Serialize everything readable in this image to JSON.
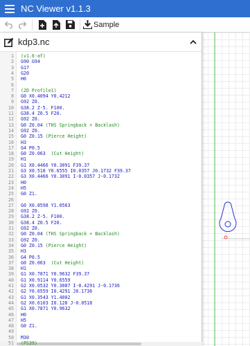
{
  "app": {
    "title": "NC Viewer  v1.1.3"
  },
  "toolbar": {
    "sample_label": "Sample"
  },
  "file": {
    "name": "kdp3.nc"
  },
  "colors": {
    "titlebar": "#2f6fd0",
    "keyword": "#1a1ac0",
    "comment": "#238a22",
    "toolpath": "#2233dd",
    "origin_marker": "#e04040",
    "axis_y": "#33b033"
  },
  "lines": [
    {
      "n": "1",
      "text": "(v1.6-af)",
      "kind": "comment"
    },
    {
      "n": "2",
      "text": "G90 G94",
      "kind": "code"
    },
    {
      "n": "3",
      "text": "G17",
      "kind": "code"
    },
    {
      "n": "4",
      "text": "G20",
      "kind": "code"
    },
    {
      "n": "5",
      "text": "H0",
      "kind": "code"
    },
    {
      "n": "6",
      "text": "",
      "kind": "code"
    },
    {
      "n": "7",
      "text": "(2D Profile1)",
      "kind": "comment"
    },
    {
      "n": "8",
      "text": "G0 X0.4094 Y0.4212",
      "kind": "code"
    },
    {
      "n": "9",
      "text": "G92 Z0.",
      "kind": "code"
    },
    {
      "n": "10",
      "text": "G38.2 Z-5. F100.",
      "kind": "code"
    },
    {
      "n": "11",
      "text": "G38.4 Z0.5 F20.",
      "kind": "code"
    },
    {
      "n": "12",
      "text": "G92 Z0.",
      "kind": "code"
    },
    {
      "n": "13",
      "text": "G0 Z0.04",
      "comment": " (THS Springback + Backlash)",
      "kind": "mixed"
    },
    {
      "n": "14",
      "text": "G92 Z0.",
      "kind": "code"
    },
    {
      "n": "15",
      "text": "G0 Z0.15",
      "comment": " (Pierce Height)",
      "kind": "mixed"
    },
    {
      "n": "16",
      "text": "H3",
      "kind": "code"
    },
    {
      "n": "17",
      "text": "G4 P0.5",
      "kind": "code"
    },
    {
      "n": "18",
      "text": "G0 Z0.063",
      "comment": "  (Cut Height)",
      "kind": "mixed"
    },
    {
      "n": "19",
      "text": "H1",
      "kind": "code"
    },
    {
      "n": "20",
      "text": "G1 X0.4466 Y0.3091 F39.37",
      "kind": "code"
    },
    {
      "n": "21",
      "text": "G3 X0.518 Y0.6555 I0.0357 J0.1732 F39.37",
      "kind": "code"
    },
    {
      "n": "22",
      "text": "G3 X0.4466 Y0.3091 I-0.0357 J-0.1732",
      "kind": "code"
    },
    {
      "n": "23",
      "text": "H0",
      "kind": "code"
    },
    {
      "n": "24",
      "text": "H5",
      "kind": "code"
    },
    {
      "n": "25",
      "text": "G0 Z1.",
      "kind": "code"
    },
    {
      "n": "26",
      "text": "",
      "kind": "code"
    },
    {
      "n": "27",
      "text": "G0 X0.8598 Y1.0563",
      "kind": "code"
    },
    {
      "n": "28",
      "text": "G92 Z0.",
      "kind": "code"
    },
    {
      "n": "29",
      "text": "G38.2 Z-5. F100.",
      "kind": "code"
    },
    {
      "n": "30",
      "text": "G38.4 Z0.5 F20.",
      "kind": "code"
    },
    {
      "n": "31",
      "text": "G92 Z0.",
      "kind": "code"
    },
    {
      "n": "32",
      "text": "G0 Z0.04",
      "comment": " (THS Springback + Backlash)",
      "kind": "mixed"
    },
    {
      "n": "33",
      "text": "G92 Z0.",
      "kind": "code"
    },
    {
      "n": "34",
      "text": "G0 Z0.15",
      "comment": " (Pierce Height)",
      "kind": "mixed"
    },
    {
      "n": "35",
      "text": "H3",
      "kind": "code"
    },
    {
      "n": "36",
      "text": "G4 P0.5",
      "kind": "code"
    },
    {
      "n": "37",
      "text": "G0 Z0.063",
      "comment": "  (Cut Height)",
      "kind": "mixed"
    },
    {
      "n": "38",
      "text": "H1",
      "kind": "code"
    },
    {
      "n": "39",
      "text": "G1 X0.7871 Y0.9632 F39.37",
      "kind": "code"
    },
    {
      "n": "40",
      "text": "G1 X0.9114 Y0.6559",
      "kind": "code"
    },
    {
      "n": "41",
      "text": "G2 X0.0532 Y0.3087 I-0.4291 J-0.1736",
      "kind": "code"
    },
    {
      "n": "42",
      "text": "G2 Y0.6559 I0.4291 J0.1736",
      "kind": "code"
    },
    {
      "n": "43",
      "text": "G1 X0.3543 Y1.4002",
      "kind": "code"
    },
    {
      "n": "44",
      "text": "G2 X0.6103 I0.128 J-0.0518",
      "kind": "code"
    },
    {
      "n": "45",
      "text": "G1 X0.7871 Y0.9632",
      "kind": "code"
    },
    {
      "n": "46",
      "text": "H0",
      "kind": "code"
    },
    {
      "n": "47",
      "text": "H5",
      "kind": "code"
    },
    {
      "n": "48",
      "text": "G0 Z1.",
      "kind": "code"
    },
    {
      "n": "49",
      "text": "",
      "kind": "code"
    },
    {
      "n": "50",
      "text": "M30",
      "kind": "code"
    },
    {
      "n": "51",
      "text": "(PS39)",
      "kind": "comment"
    },
    {
      "n": "52",
      "text": "",
      "kind": "code"
    }
  ]
}
